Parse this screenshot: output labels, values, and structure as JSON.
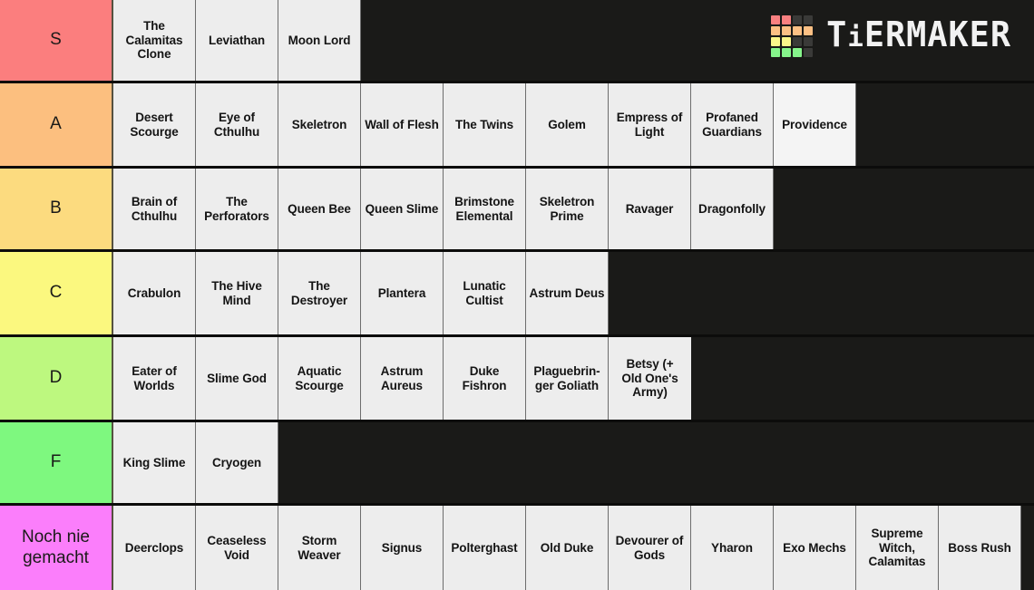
{
  "brand": {
    "name": "TiERMAKER",
    "name_upper": "TIERMAKER",
    "logo_icon": "tiermaker-grid-logo",
    "logo_colors": [
      "#f98080",
      "#f98080",
      "#3a3a38",
      "#3a3a38",
      "#fcc084",
      "#fcc084",
      "#fcc084",
      "#fcc084",
      "#fbf78a",
      "#fbf78a",
      "#3a3a38",
      "#3a3a38",
      "#86f58b",
      "#86f58b",
      "#86f58b",
      "#3a3a38"
    ]
  },
  "page": {
    "background": "#1a1a18",
    "tile_background": "#ededed",
    "tile_text_color": "#141414",
    "tile_border_color": "#6d6d6d"
  },
  "tiers": [
    {
      "label": "S",
      "color": "#fb7e7e",
      "items": [
        {
          "label": "The Calamitas Clone"
        },
        {
          "label": "Leviathan"
        },
        {
          "label": "Moon Lord"
        }
      ]
    },
    {
      "label": "A",
      "color": "#fcbf7f",
      "items": [
        {
          "label": "Desert Scourge"
        },
        {
          "label": "Eye of Cthulhu"
        },
        {
          "label": "Skeletron"
        },
        {
          "label": "Wall of Flesh"
        },
        {
          "label": "The Twins"
        },
        {
          "label": "Golem"
        },
        {
          "label": "Empress of Light"
        },
        {
          "label": "Profaned Guardians"
        },
        {
          "label": "Providence",
          "variant": "bright"
        }
      ]
    },
    {
      "label": "B",
      "color": "#fcdb7f",
      "items": [
        {
          "label": "Brain of Cthulhu"
        },
        {
          "label": "The Perforators"
        },
        {
          "label": "Queen Bee"
        },
        {
          "label": "Queen Slime"
        },
        {
          "label": "Brimstone Elemental"
        },
        {
          "label": "Skeletron Prime"
        },
        {
          "label": "Ravager"
        },
        {
          "label": "Dragonfolly"
        }
      ]
    },
    {
      "label": "C",
      "color": "#fbf87f",
      "items": [
        {
          "label": "Crabulon"
        },
        {
          "label": "The Hive Mind"
        },
        {
          "label": "The Destroyer"
        },
        {
          "label": "Plantera"
        },
        {
          "label": "Lunatic Cultist"
        },
        {
          "label": "Astrum Deus"
        }
      ]
    },
    {
      "label": "D",
      "color": "#bdf87f",
      "items": [
        {
          "label": "Eater of Worlds"
        },
        {
          "label": "Slime God"
        },
        {
          "label": "Aquatic Scourge"
        },
        {
          "label": "Astrum Aureus"
        },
        {
          "label": "Duke Fishron"
        },
        {
          "label": "Plaguebringer Goliath",
          "display": "Plaguebrin-\nger Goliath"
        },
        {
          "label": "Betsy (+ Old One's Army)",
          "display": "Betsy (+\nOld One's\nArmy)",
          "variant": "sep"
        }
      ]
    },
    {
      "label": "F",
      "color": "#7ef87f",
      "items": [
        {
          "label": "King Slime"
        },
        {
          "label": "Cryogen"
        }
      ]
    },
    {
      "label": "Noch nie gemacht",
      "color": "#fb7efb",
      "items": [
        {
          "label": "Deerclops"
        },
        {
          "label": "Ceaseless Void"
        },
        {
          "label": "Storm Weaver"
        },
        {
          "label": "Signus"
        },
        {
          "label": "Polterghast"
        },
        {
          "label": "Old Duke"
        },
        {
          "label": "Devourer of Gods"
        },
        {
          "label": "Yharon"
        },
        {
          "label": "Exo Mechs"
        },
        {
          "label": "Supreme Witch, Calamitas"
        },
        {
          "label": "Boss Rush"
        }
      ]
    }
  ]
}
